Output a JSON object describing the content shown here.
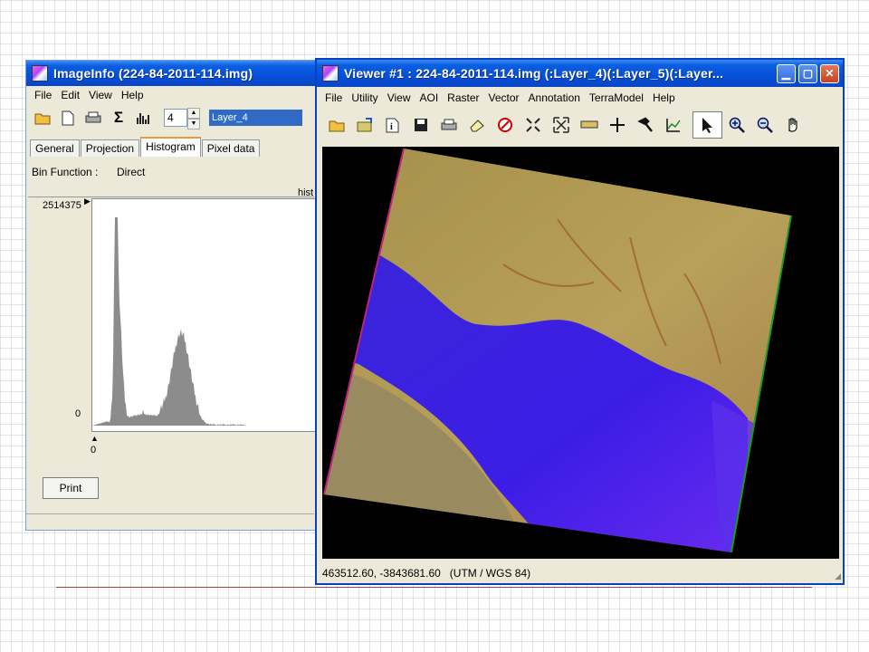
{
  "imageinfo": {
    "title": "ImageInfo (224-84-2011-114.img)",
    "menu": [
      "File",
      "Edit",
      "View",
      "Help"
    ],
    "toolbar_icons": [
      "open-folder-icon",
      "new-document-icon",
      "printer-icon",
      "sigma-icon",
      "histogram-icon"
    ],
    "band_number": "4",
    "layer_name": "Layer_4",
    "tabs": [
      "General",
      "Projection",
      "Histogram",
      "Pixel data"
    ],
    "active_tab": "Histogram",
    "bin_function_label": "Bin Function :",
    "bin_function_value": "Direct",
    "histogram_label": "hist",
    "y_max": "2514375",
    "y_min": "0",
    "x_min": "0",
    "print_label": "Print"
  },
  "viewer": {
    "title": "Viewer #1 : 224-84-2011-114.img (:Layer_4)(:Layer_5)(:Layer...",
    "menu": [
      "File",
      "Utility",
      "View",
      "AOI",
      "Raster",
      "Vector",
      "Annotation",
      "TerraModel",
      "Help"
    ],
    "toolbar_icons": [
      "open-folder-icon",
      "open-layer-icon",
      "info-icon",
      "save-icon",
      "printer-icon",
      "eraser-icon",
      "clear-icon",
      "zoom-in-fit-icon",
      "zoom-out-fit-icon",
      "measure-icon",
      "crosshair-icon",
      "hammer-icon",
      "profile-icon",
      "pointer-icon",
      "zoom-in-icon",
      "zoom-out-icon",
      "pan-hand-icon"
    ],
    "status_coords": "463512.60, -3843681.60",
    "status_projection": "(UTM / WGS 84)"
  },
  "colors": {
    "titlebar": "#0550d8",
    "water": "#3c1de6",
    "land": "#b29a52"
  }
}
